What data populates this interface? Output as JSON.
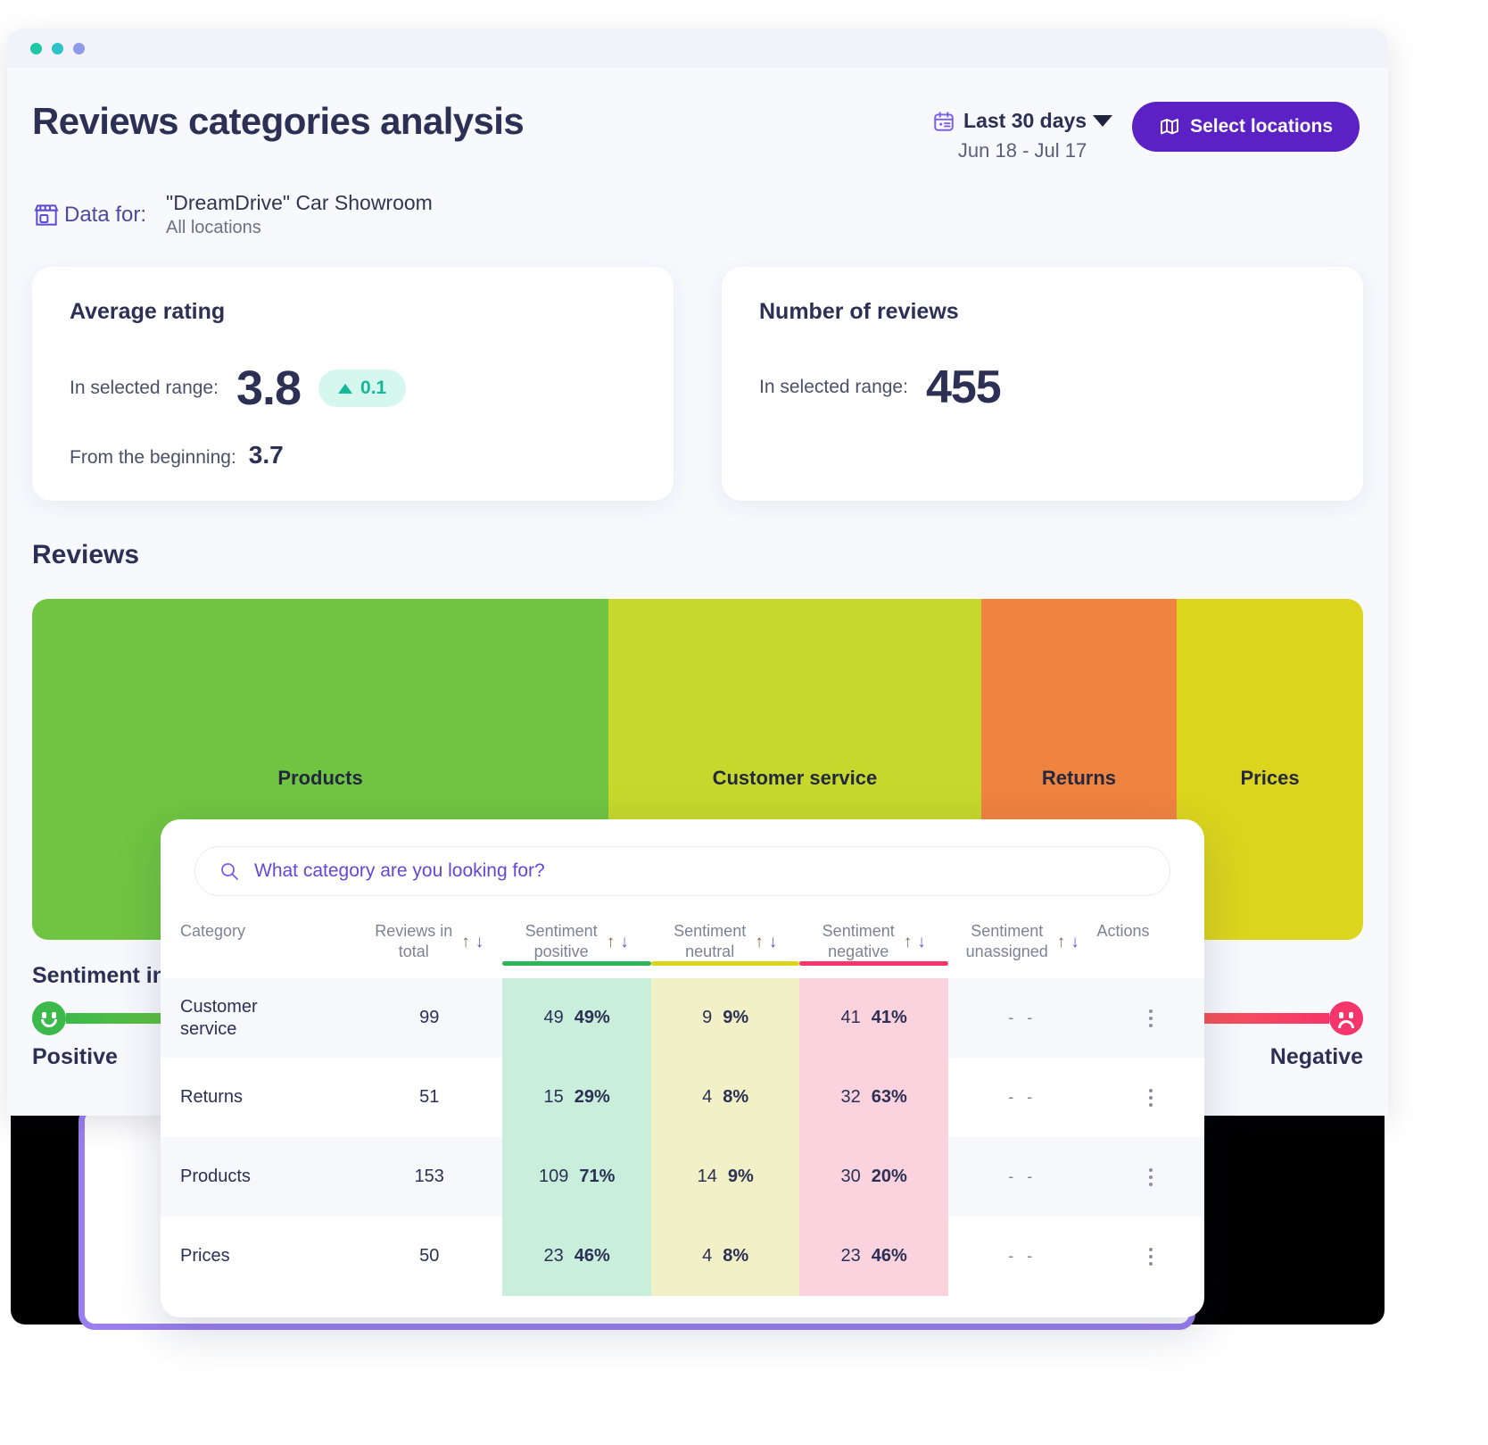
{
  "window": {
    "dots": [
      "green",
      "teal",
      "purple"
    ]
  },
  "header": {
    "title": "Reviews categories analysis",
    "date_range": {
      "label": "Last 30 days",
      "sub": "Jun 18 - Jul 17",
      "icon": "calendar-icon",
      "caret": "chevron-down-icon"
    },
    "locations_button": {
      "label": "Select locations",
      "icon": "map-icon",
      "color": "#5b21c4"
    }
  },
  "data_for": {
    "label": "Data for:",
    "icon": "store-icon",
    "business": "\"DreamDrive\" Car Showroom",
    "scope": "All locations"
  },
  "cards": {
    "average_rating": {
      "title": "Average rating",
      "range_label": "In selected range:",
      "range_value": "3.8",
      "delta": "0.1",
      "delta_direction": "up",
      "delta_color": "#14b79a",
      "beginning_label": "From the beginning:",
      "beginning_value": "3.7"
    },
    "number_of_reviews": {
      "title": "Number of reviews",
      "range_label": "In selected range:",
      "range_value": "455"
    }
  },
  "reviews": {
    "section_title": "Reviews",
    "sentiment_caption": "Sentiment in",
    "scale": {
      "positive_label": "Positive",
      "negative_label": "Negative",
      "positive_icon": "happy-face-icon",
      "negative_icon": "sad-face-icon",
      "gradient_start": "#3cb94b",
      "gradient_end": "#f6366a"
    }
  },
  "chart_data": {
    "type": "treemap",
    "title": "Reviews",
    "xlabel": "",
    "ylabel": "",
    "legend": "sentiment color scale from Positive (green) to Negative (red)",
    "categories": [
      "Products",
      "Customer service",
      "Returns",
      "Prices"
    ],
    "values": [
      153,
      99,
      51,
      50
    ],
    "widths_pct": [
      43.3,
      28.0,
      14.7,
      14.0
    ],
    "colors": [
      "#6fc542",
      "#c5d82b",
      "#ef8340",
      "#dbd51e"
    ],
    "sentiment_scores": [
      71,
      49,
      29,
      46
    ]
  },
  "panel": {
    "search": {
      "placeholder": "What category are you looking for?",
      "value": "",
      "icon": "search-icon"
    },
    "table": {
      "columns": [
        {
          "key": "category",
          "label": "Category",
          "sortable": false
        },
        {
          "key": "total",
          "label": "Reviews in total",
          "line1": "Reviews in",
          "line2": "total",
          "sortable": true
        },
        {
          "key": "positive",
          "label": "Sentiment positive",
          "line1": "Sentiment",
          "line2": "positive",
          "sortable": true,
          "accent": "#2fb457"
        },
        {
          "key": "neutral",
          "label": "Sentiment neutral",
          "line1": "Sentiment",
          "line2": "neutral",
          "sortable": true,
          "accent": "#dbd519"
        },
        {
          "key": "negative",
          "label": "Sentiment negative",
          "line1": "Sentiment",
          "line2": "negative",
          "sortable": true,
          "accent": "#f6366a"
        },
        {
          "key": "unassigned",
          "label": "Sentiment unassigned",
          "line1": "Sentiment",
          "line2": "unassigned",
          "sortable": true
        },
        {
          "key": "actions",
          "label": "Actions",
          "sortable": false
        }
      ],
      "sort_icons": {
        "asc": "↑",
        "desc": "↓"
      },
      "rows": [
        {
          "category": "Customer service",
          "cat_line1": "Customer",
          "cat_line2": "service",
          "total": "99",
          "positive_n": "49",
          "positive_p": "49%",
          "neutral_n": "9",
          "neutral_p": "9%",
          "negative_n": "41",
          "negative_p": "41%",
          "unassigned": "- -",
          "actions_icon": "kebab-menu-icon"
        },
        {
          "category": "Returns",
          "cat_line1": "Returns",
          "cat_line2": "",
          "total": "51",
          "positive_n": "15",
          "positive_p": "29%",
          "neutral_n": "4",
          "neutral_p": "8%",
          "negative_n": "32",
          "negative_p": "63%",
          "unassigned": "- -",
          "actions_icon": "kebab-menu-icon"
        },
        {
          "category": "Products",
          "cat_line1": "Products",
          "cat_line2": "",
          "total": "153",
          "positive_n": "109",
          "positive_p": "71%",
          "neutral_n": "14",
          "neutral_p": "9%",
          "negative_n": "30",
          "negative_p": "20%",
          "unassigned": "- -",
          "actions_icon": "kebab-menu-icon"
        },
        {
          "category": "Prices",
          "cat_line1": "Prices",
          "cat_line2": "",
          "total": "50",
          "positive_n": "23",
          "positive_p": "46%",
          "neutral_n": "4",
          "neutral_p": "8%",
          "negative_n": "23",
          "negative_p": "46%",
          "unassigned": "- -",
          "actions_icon": "kebab-menu-icon"
        }
      ]
    }
  }
}
